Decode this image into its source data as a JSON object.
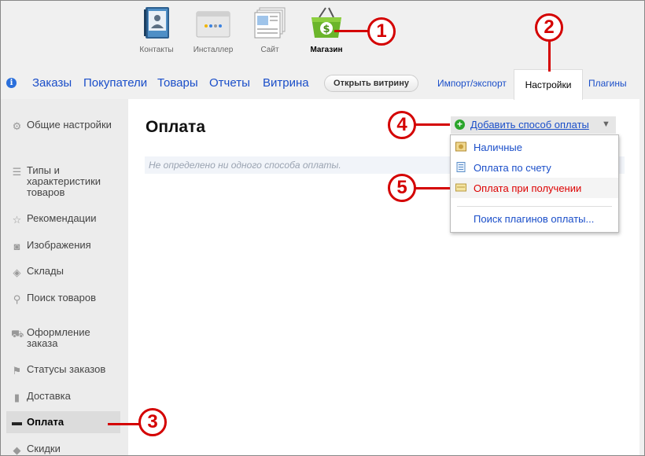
{
  "apps": [
    {
      "label": "Контакты",
      "icon": "contacts-book-icon"
    },
    {
      "label": "Инсталлер",
      "icon": "installer-window-icon"
    },
    {
      "label": "Сайт",
      "icon": "site-pages-icon"
    },
    {
      "label": "Магазин",
      "icon": "shop-basket-icon",
      "active": true
    }
  ],
  "nav": {
    "links": [
      "Заказы",
      "Покупатели",
      "Товары",
      "Отчеты",
      "Витрина"
    ],
    "open_storefront": "Открыть витрину",
    "import_export": "Импорт/экспорт",
    "settings": "Настройки",
    "plugins": "Плагины"
  },
  "sidebar": {
    "items": [
      {
        "label": "Общие настройки",
        "icon": "gears-icon"
      },
      {
        "label": "Типы и характеристики товаров",
        "icon": "list-icon"
      },
      {
        "label": "Рекомендации",
        "icon": "star-icon"
      },
      {
        "label": "Изображения",
        "icon": "camera-icon"
      },
      {
        "label": "Склады",
        "icon": "box-icon"
      },
      {
        "label": "Поиск товаров",
        "icon": "magnifier-icon"
      },
      {
        "label": "Оформление заказа",
        "icon": "cart-icon"
      },
      {
        "label": "Статусы заказов",
        "icon": "flag-icon"
      },
      {
        "label": "Доставка",
        "icon": "truck-icon"
      },
      {
        "label": "Оплата",
        "icon": "money-icon",
        "selected": true
      },
      {
        "label": "Скидки",
        "icon": "tag-icon"
      }
    ]
  },
  "main": {
    "title": "Оплата",
    "empty_message": "Не определено ни одного способа оплаты.",
    "add_button": "Добавить способ оплаты",
    "dropdown": [
      {
        "label": "Наличные",
        "icon": "cash-icon"
      },
      {
        "label": "Оплата по счету",
        "icon": "invoice-icon"
      },
      {
        "label": "Оплата при получении",
        "icon": "cod-icon",
        "highlighted": true
      },
      {
        "label": "Поиск плагинов оплаты...",
        "icon": ""
      }
    ]
  },
  "callouts": [
    "1",
    "2",
    "3",
    "4",
    "5"
  ],
  "colors": {
    "accent_link": "#1a4ec9",
    "callout_red": "#d40000",
    "highlight_red": "#dd0000"
  }
}
